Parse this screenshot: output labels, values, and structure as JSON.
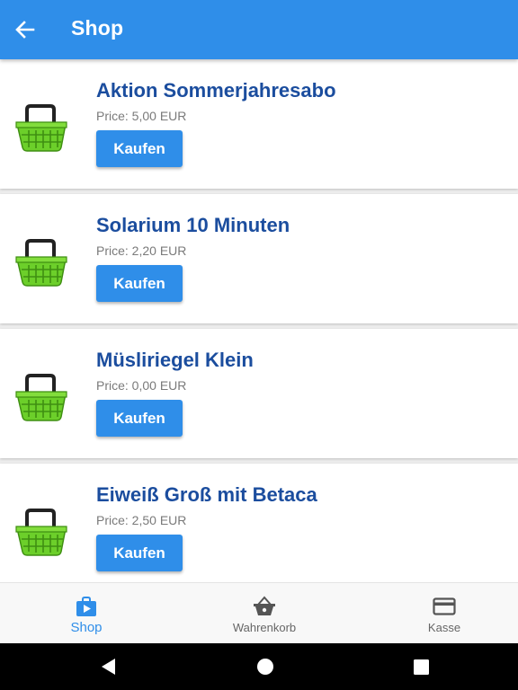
{
  "header": {
    "title": "Shop",
    "back_icon": "arrow-left-icon"
  },
  "products": [
    {
      "name": "Aktion Sommerjahresabo",
      "price": "Price: 5,00 EUR",
      "buy_label": "Kaufen"
    },
    {
      "name": "Solarium 10 Minuten",
      "price": "Price: 2,20 EUR",
      "buy_label": "Kaufen"
    },
    {
      "name": "Müsliriegel Klein",
      "price": "Price: 0,00 EUR",
      "buy_label": "Kaufen"
    },
    {
      "name": "Eiweiß Groß mit Betaca",
      "price": "Price: 2,50 EUR",
      "buy_label": "Kaufen"
    }
  ],
  "bottom_nav": [
    {
      "label": "Shop",
      "icon": "shop-bag-icon",
      "active": true
    },
    {
      "label": "Wahrenkorb",
      "icon": "basket-icon",
      "active": false
    },
    {
      "label": "Kasse",
      "icon": "credit-card-icon",
      "active": false
    }
  ],
  "colors": {
    "primary": "#2f8ee9",
    "product_name": "#1b4d9e",
    "basket_green": "#6ccf2a"
  },
  "system_nav": [
    "back-triangle-icon",
    "home-circle-icon",
    "recents-square-icon"
  ]
}
